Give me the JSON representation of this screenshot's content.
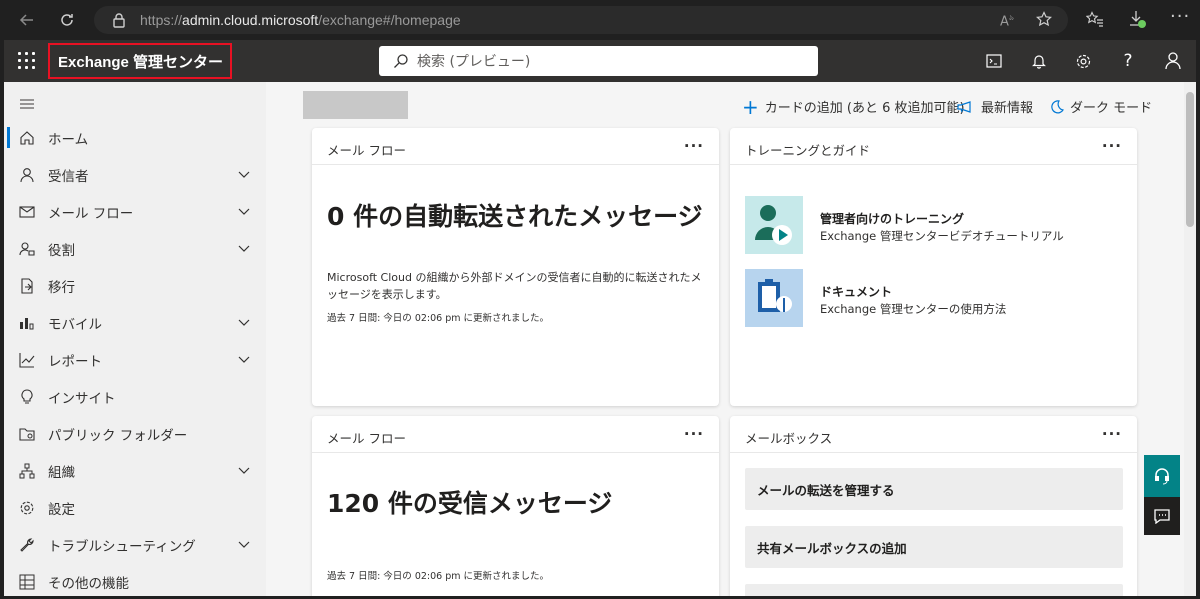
{
  "browser": {
    "url_scheme": "https://",
    "url_host": "admin.cloud.microsoft",
    "url_path": "/exchange#/homepage"
  },
  "app": {
    "title": "Exchange 管理センター",
    "search_placeholder": "検索 (プレビュー)"
  },
  "sidebar": {
    "items": [
      {
        "label": "ホーム",
        "icon": "home-icon",
        "chevron": false
      },
      {
        "label": "受信者",
        "icon": "person-icon",
        "chevron": true
      },
      {
        "label": "メール フロー",
        "icon": "mail-icon",
        "chevron": true
      },
      {
        "label": "役割",
        "icon": "role-icon",
        "chevron": true
      },
      {
        "label": "移行",
        "icon": "migration-icon",
        "chevron": false
      },
      {
        "label": "モバイル",
        "icon": "mobile-icon",
        "chevron": true
      },
      {
        "label": "レポート",
        "icon": "report-icon",
        "chevron": true
      },
      {
        "label": "インサイト",
        "icon": "lightbulb-icon",
        "chevron": false
      },
      {
        "label": "パブリック フォルダー",
        "icon": "folder-icon",
        "chevron": false
      },
      {
        "label": "組織",
        "icon": "org-icon",
        "chevron": true
      },
      {
        "label": "設定",
        "icon": "settings-icon",
        "chevron": false
      },
      {
        "label": "トラブルシューティング",
        "icon": "wrench-icon",
        "chevron": true
      },
      {
        "label": "その他の機能",
        "icon": "grid-icon",
        "chevron": false
      }
    ]
  },
  "commands": {
    "add_card": "カードの追加 (あと 6 枚追加可能)",
    "whats_new": "最新情報",
    "dark_mode": "ダーク モード"
  },
  "cards": {
    "mailflow1": {
      "title": "メール フロー",
      "big": "0 件の自動転送されたメッセージ",
      "desc": "Microsoft Cloud の組織から外部ドメインの受信者に自動的に転送されたメッセージを表示します。",
      "updated": "過去 7 日間: 今日の 02:06 pm に更新されました。"
    },
    "training": {
      "title": "トレーニングとガイド",
      "item1_title": "管理者向けのトレーニング",
      "item1_sub": "Exchange 管理センタービデオチュートリアル",
      "item2_title": "ドキュメント",
      "item2_sub": "Exchange 管理センターの使用方法"
    },
    "mailflow2": {
      "title": "メール フロー",
      "big": "120 件の受信メッセージ",
      "updated": "過去 7 日間: 今日の 02:06 pm に更新されました。"
    },
    "mailbox": {
      "title": "メールボックス",
      "btn1": "メールの転送を管理する",
      "btn2": "共有メールボックスの追加"
    }
  },
  "colors": {
    "topbar": "#323130",
    "accent": "#0078d4",
    "highlight_border": "#e81123",
    "teal": "#038387"
  }
}
